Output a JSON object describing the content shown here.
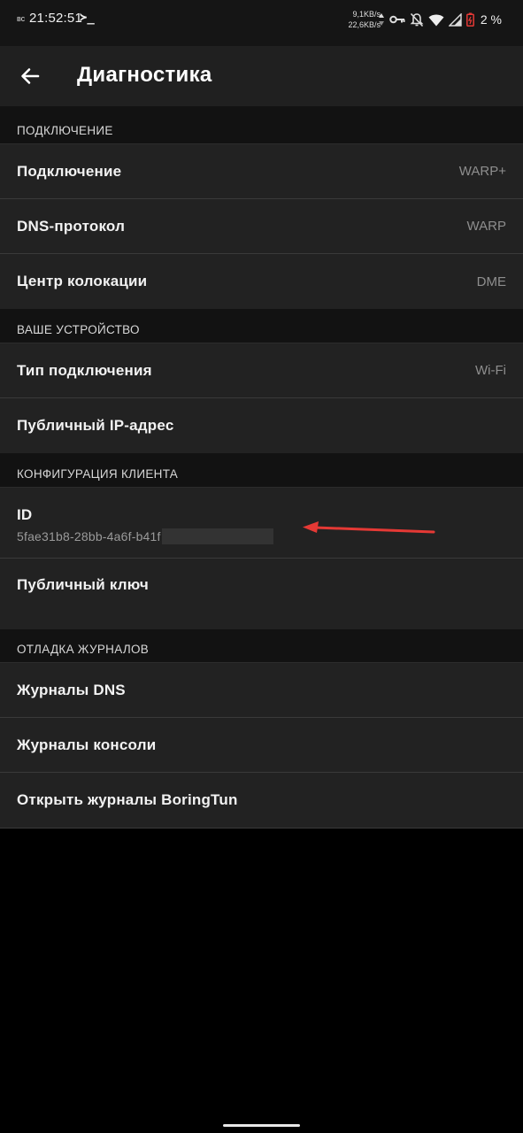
{
  "status_bar": {
    "day": "вс",
    "time": "21:52:51",
    "terminal_glyph": "≻_",
    "speed_up": "9,1KB/s",
    "speed_down": "22,6KB/s",
    "battery_percent": "2 %",
    "icons": [
      "data-arrows-icon",
      "vpn-key-icon",
      "bell-off-icon",
      "wifi-icon",
      "cell-signal-icon",
      "battery-low-icon"
    ]
  },
  "appbar": {
    "title": "Диагностика"
  },
  "sections": {
    "connection": {
      "header": "ПОДКЛЮЧЕНИЕ",
      "rows": [
        {
          "label": "Подключение",
          "value": "WARP+"
        },
        {
          "label": "DNS-протокол",
          "value": "WARP"
        },
        {
          "label": "Центр колокации",
          "value": "DME"
        }
      ]
    },
    "device": {
      "header": "ВАШЕ УСТРОЙСТВО",
      "rows": [
        {
          "label": "Тип подключения",
          "value": "Wi-Fi"
        },
        {
          "label": "Публичный IP-адрес",
          "value": ""
        }
      ]
    },
    "client": {
      "header": "КОНФИГУРАЦИЯ КЛИЕНТА",
      "id_label": "ID",
      "id_value": "5fae31b8-28bb-4a6f-b41f",
      "public_key_label": "Публичный ключ"
    },
    "logs": {
      "header": "ОТЛАДКА ЖУРНАЛОВ",
      "rows": [
        {
          "label": "Журналы DNS"
        },
        {
          "label": "Журналы консоли"
        },
        {
          "label": "Открыть журналы BoringTun"
        }
      ]
    }
  },
  "colors": {
    "background": "#000000",
    "appbar": "#202020",
    "row": "#222222",
    "section_header": "#121212",
    "value_text": "#8e8e8e",
    "annotation_arrow": "#e53935",
    "battery_low": "#e53935"
  }
}
